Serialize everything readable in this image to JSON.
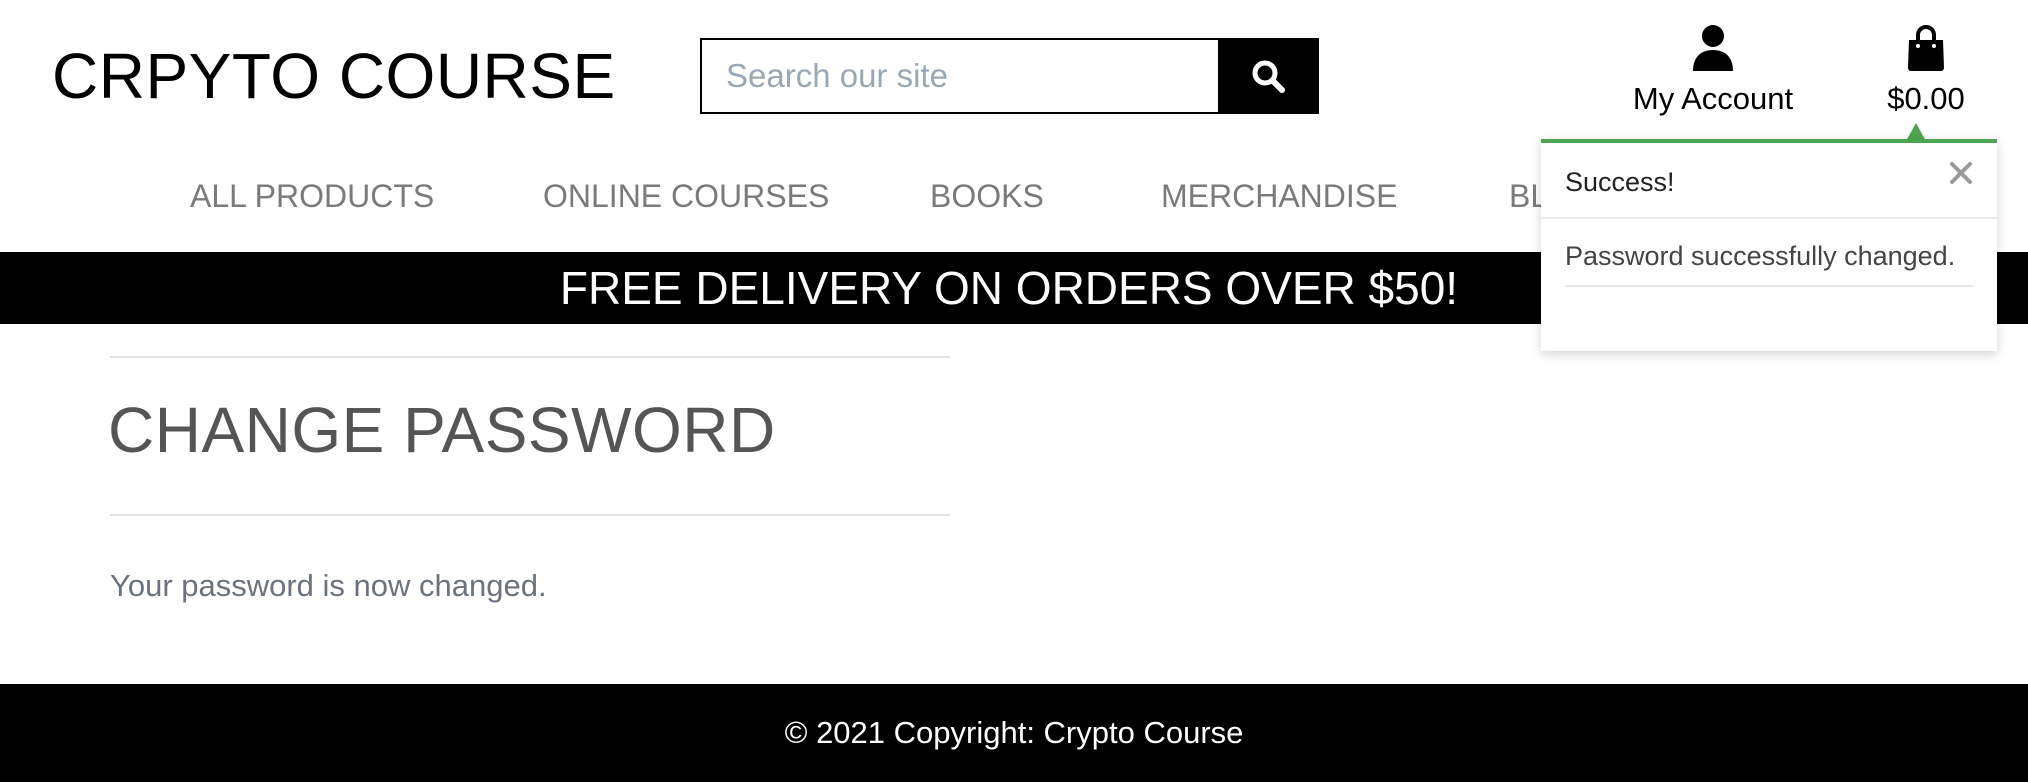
{
  "header": {
    "brand": "CRPYTO COURSE",
    "search": {
      "placeholder": "Search our site",
      "value": "",
      "button_icon": "search-icon"
    },
    "account": {
      "label": "My Account",
      "icon": "user-icon"
    },
    "cart": {
      "total": "$0.00",
      "icon": "shopping-bag-icon"
    }
  },
  "nav": {
    "items": [
      {
        "label": "ALL PRODUCTS"
      },
      {
        "label": "ONLINE COURSES"
      },
      {
        "label": "BOOKS"
      },
      {
        "label": "MERCHANDISE"
      },
      {
        "label": "BL"
      }
    ]
  },
  "banner": {
    "text": "FREE DELIVERY ON ORDERS OVER $50!"
  },
  "main": {
    "title": "CHANGE PASSWORD",
    "message": "Your password is now changed."
  },
  "footer": {
    "text": "© 2021 Copyright: Crypto Course"
  },
  "toast": {
    "title": "Success!",
    "message": "Password successfully changed.",
    "close_icon": "close-icon",
    "accent_color": "#4ea551"
  }
}
